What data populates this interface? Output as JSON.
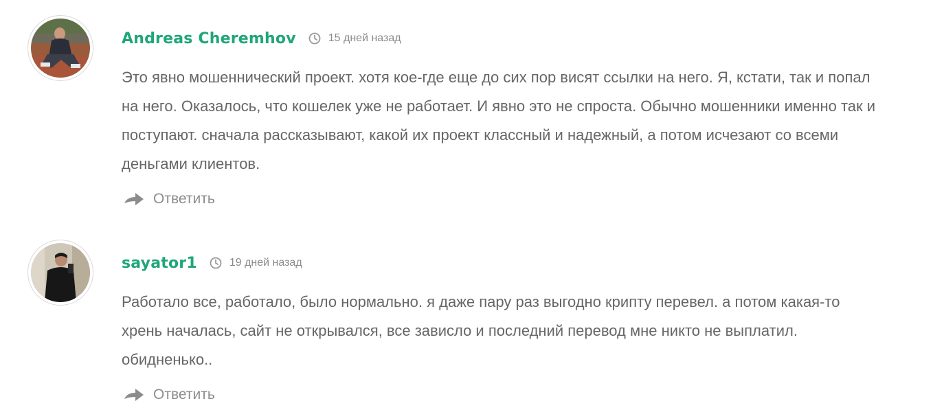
{
  "comments": [
    {
      "author": "Andreas Cheremhov",
      "time": "15 дней назад",
      "text": "Это явно мошеннический проект. хотя кое-где еще до сих пор висят ссылки на него. Я, кстати, так и попал на него. Оказалось, что кошелек уже не работает. И явно это не спроста. Обычно мошенники именно так и поступают. сначала рассказывают, какой их проект классный и надежный, а потом исчезают со всеми деньгами клиентов.",
      "reply_label": "Ответить"
    },
    {
      "author": "sayator1",
      "time": "19 дней назад",
      "text": "Работало все, работало, было нормально. я даже пару раз выгодно крипту перевел. а потом какая-то хрень началась, сайт не открывался, все зависло и последний перевод мне никто не выплатил. обидненько..",
      "reply_label": "Ответить"
    }
  ],
  "colors": {
    "author": "#1fa67a",
    "text": "#666666",
    "meta": "#8a8a8a",
    "reply": "#8c8c8c"
  },
  "icons": {
    "time": "clock-icon",
    "reply": "reply-arrow-icon"
  }
}
